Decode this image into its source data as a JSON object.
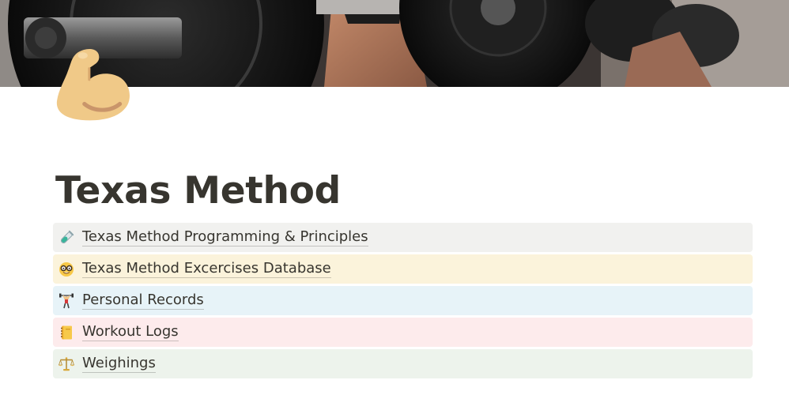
{
  "cover": {
    "image": "barbell-deadlift-photo"
  },
  "page": {
    "icon": "flexed-biceps-icon",
    "title": "Texas Method"
  },
  "links": [
    {
      "icon": "test-tube-icon",
      "label": "Texas Method Programming & Principles",
      "background": "#f1f1ef"
    },
    {
      "icon": "nerd-face-icon",
      "label": "Texas Method Excercises Database",
      "background": "#fbf3db"
    },
    {
      "icon": "weight-lifter-icon",
      "label": "Personal Records",
      "background": "#e7f3f8"
    },
    {
      "icon": "ledger-icon",
      "label": "Workout Logs",
      "background": "#fdebec"
    },
    {
      "icon": "balance-scale-icon",
      "label": "Weighings",
      "background": "#edf3ec"
    }
  ]
}
